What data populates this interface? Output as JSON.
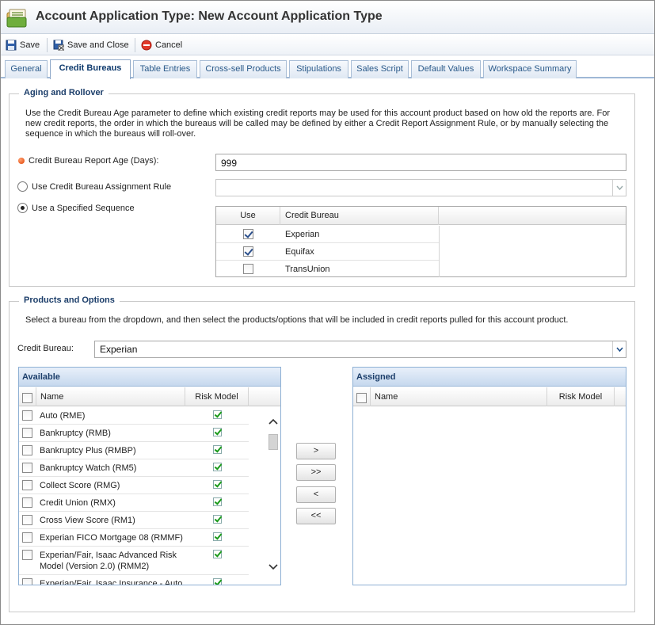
{
  "window": {
    "title": "Account Application Type: New Account Application Type"
  },
  "toolbar": {
    "save": "Save",
    "save_close": "Save and Close",
    "cancel": "Cancel"
  },
  "tabs": [
    "General",
    "Credit Bureaus",
    "Table Entries",
    "Cross-sell Products",
    "Stipulations",
    "Sales Script",
    "Default Values",
    "Workspace Summary"
  ],
  "active_tab": "Credit Bureaus",
  "aging": {
    "legend": "Aging and Rollover",
    "description_lines": [
      "Use the Credit Bureau Age parameter to define which existing credit reports may be used for this account product based on how old the reports are. For",
      "new credit reports, the order in which the bureaus will be called may be defined by either a Credit Report Assignment Rule, or by manually selecting the",
      "sequence in which the bureaus will roll-over."
    ],
    "report_age_label": "Credit Bureau Report Age (Days):",
    "report_age_value": "999",
    "assignment_rule_label": "Use Credit Bureau Assignment Rule",
    "assignment_rule_value": "",
    "sequence_label": "Use a Specified Sequence",
    "selected_option": "sequence",
    "sequence_columns": {
      "use": "Use",
      "bureau": "Credit Bureau"
    },
    "sequence_rows": [
      {
        "bureau": "Experian",
        "use": true
      },
      {
        "bureau": "Equifax",
        "use": true
      },
      {
        "bureau": "TransUnion",
        "use": false
      }
    ]
  },
  "products": {
    "legend": "Products and Options",
    "description": "Select a bureau from the dropdown, and then select the products/options that will be included in credit reports pulled for this account product.",
    "bureau_label": "Credit Bureau:",
    "bureau_value": "Experian",
    "available": {
      "title": "Available",
      "col_name": "Name",
      "col_risk": "Risk Model",
      "items": [
        {
          "name": "Auto (RME)",
          "risk": true
        },
        {
          "name": "Bankruptcy (RMB)",
          "risk": true
        },
        {
          "name": "Bankruptcy Plus (RMBP)",
          "risk": true
        },
        {
          "name": "Bankruptcy Watch (RM5)",
          "risk": true
        },
        {
          "name": "Collect Score (RMG)",
          "risk": true
        },
        {
          "name": "Credit Union (RMX)",
          "risk": true
        },
        {
          "name": "Cross View Score (RM1)",
          "risk": true
        },
        {
          "name": "Experian FICO Mortgage 08 (RMMF)",
          "risk": true
        },
        {
          "name": "Experian/Fair, Isaac Advanced Risk Model (Version 2.0) (RMM2)",
          "risk": true
        },
        {
          "name": "Experian/Fair, Isaac Insurance - Auto",
          "risk": true
        }
      ]
    },
    "assigned": {
      "title": "Assigned",
      "col_name": "Name",
      "col_risk": "Risk Model"
    },
    "buttons": {
      "add": ">",
      "add_all": ">>",
      "remove": "<",
      "remove_all": "<<"
    }
  }
}
